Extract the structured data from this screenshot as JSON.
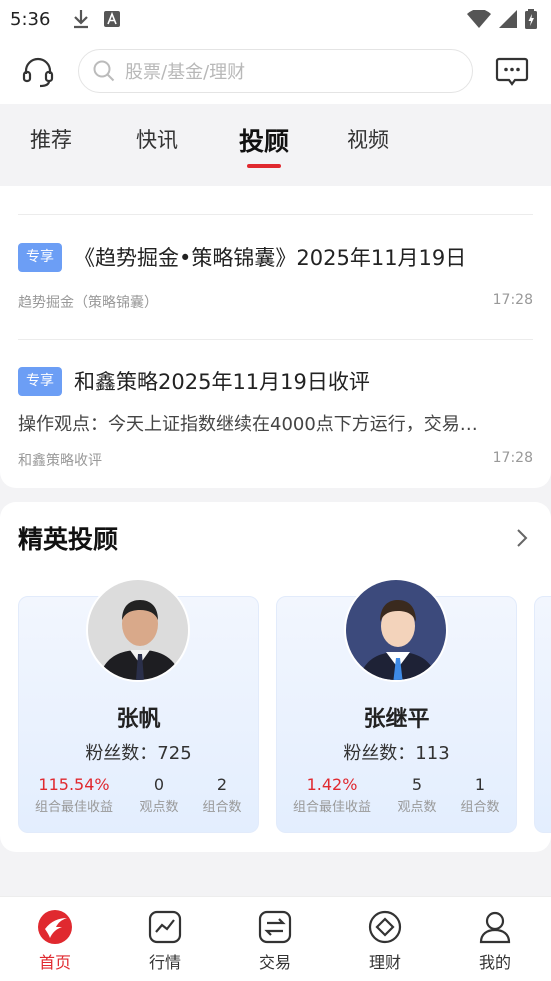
{
  "status_bar": {
    "time": "5:36"
  },
  "header": {
    "search_placeholder": "股票/基金/理财",
    "icons": [
      "headset-icon",
      "search-icon",
      "message-icon"
    ]
  },
  "tabs": [
    {
      "label": "推荐",
      "active": false
    },
    {
      "label": "快讯",
      "active": false
    },
    {
      "label": "投顾",
      "active": true
    },
    {
      "label": "视频",
      "active": false
    }
  ],
  "news": {
    "items": [
      {
        "badge": "专享",
        "title": "《趋势掘金•策略锦囊》2025年11月19日",
        "summary": "",
        "source": "趋势掘金（策略锦囊）",
        "time": "17:28"
      },
      {
        "badge": "专享",
        "title": "和鑫策略2025年11月19日收评",
        "summary": "操作观点：今天上证指数继续在4000点下方运行，交易…",
        "source": "和鑫策略收评",
        "time": "17:28"
      }
    ]
  },
  "elite": {
    "title": "精英投顾",
    "advisors": [
      {
        "name": "张帆",
        "fans": "粉丝数：725",
        "best_return": "115.54%",
        "best_return_label": "组合最佳收益",
        "views": "0",
        "views_label": "观点数",
        "portfolios": "2",
        "portfolios_label": "组合数"
      },
      {
        "name": "张继平",
        "fans": "粉丝数：113",
        "best_return": "1.42%",
        "best_return_label": "组合最佳收益",
        "views": "5",
        "views_label": "观点数",
        "portfolios": "1",
        "portfolios_label": "组合数"
      }
    ]
  },
  "bottom_nav": [
    {
      "label": "首页",
      "icon": "home-icon",
      "active": true
    },
    {
      "label": "行情",
      "icon": "market-chart-icon",
      "active": false
    },
    {
      "label": "交易",
      "icon": "trade-exchange-icon",
      "active": false
    },
    {
      "label": "理财",
      "icon": "wealth-icon",
      "active": false
    },
    {
      "label": "我的",
      "icon": "profile-icon",
      "active": false
    }
  ],
  "colors": {
    "brand_red": "#e0292f",
    "badge_blue": "#6c9ef5"
  }
}
